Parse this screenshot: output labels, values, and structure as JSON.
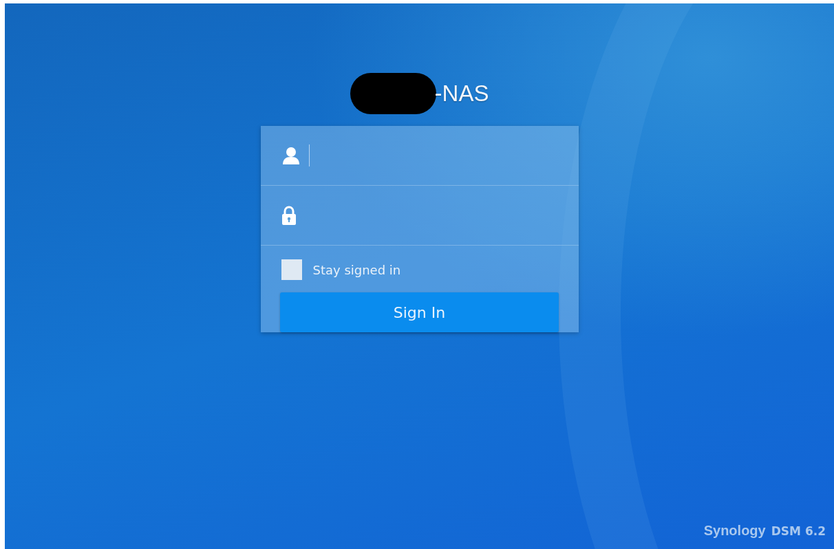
{
  "title": "-NAS",
  "title_redacted": true,
  "login": {
    "username": {
      "focused": true
    },
    "stay_signed_in": {
      "label": "Stay signed in",
      "checked": false
    },
    "button": "Sign In"
  },
  "footer": {
    "brand": "Synology",
    "product": "DSM 6.2"
  }
}
